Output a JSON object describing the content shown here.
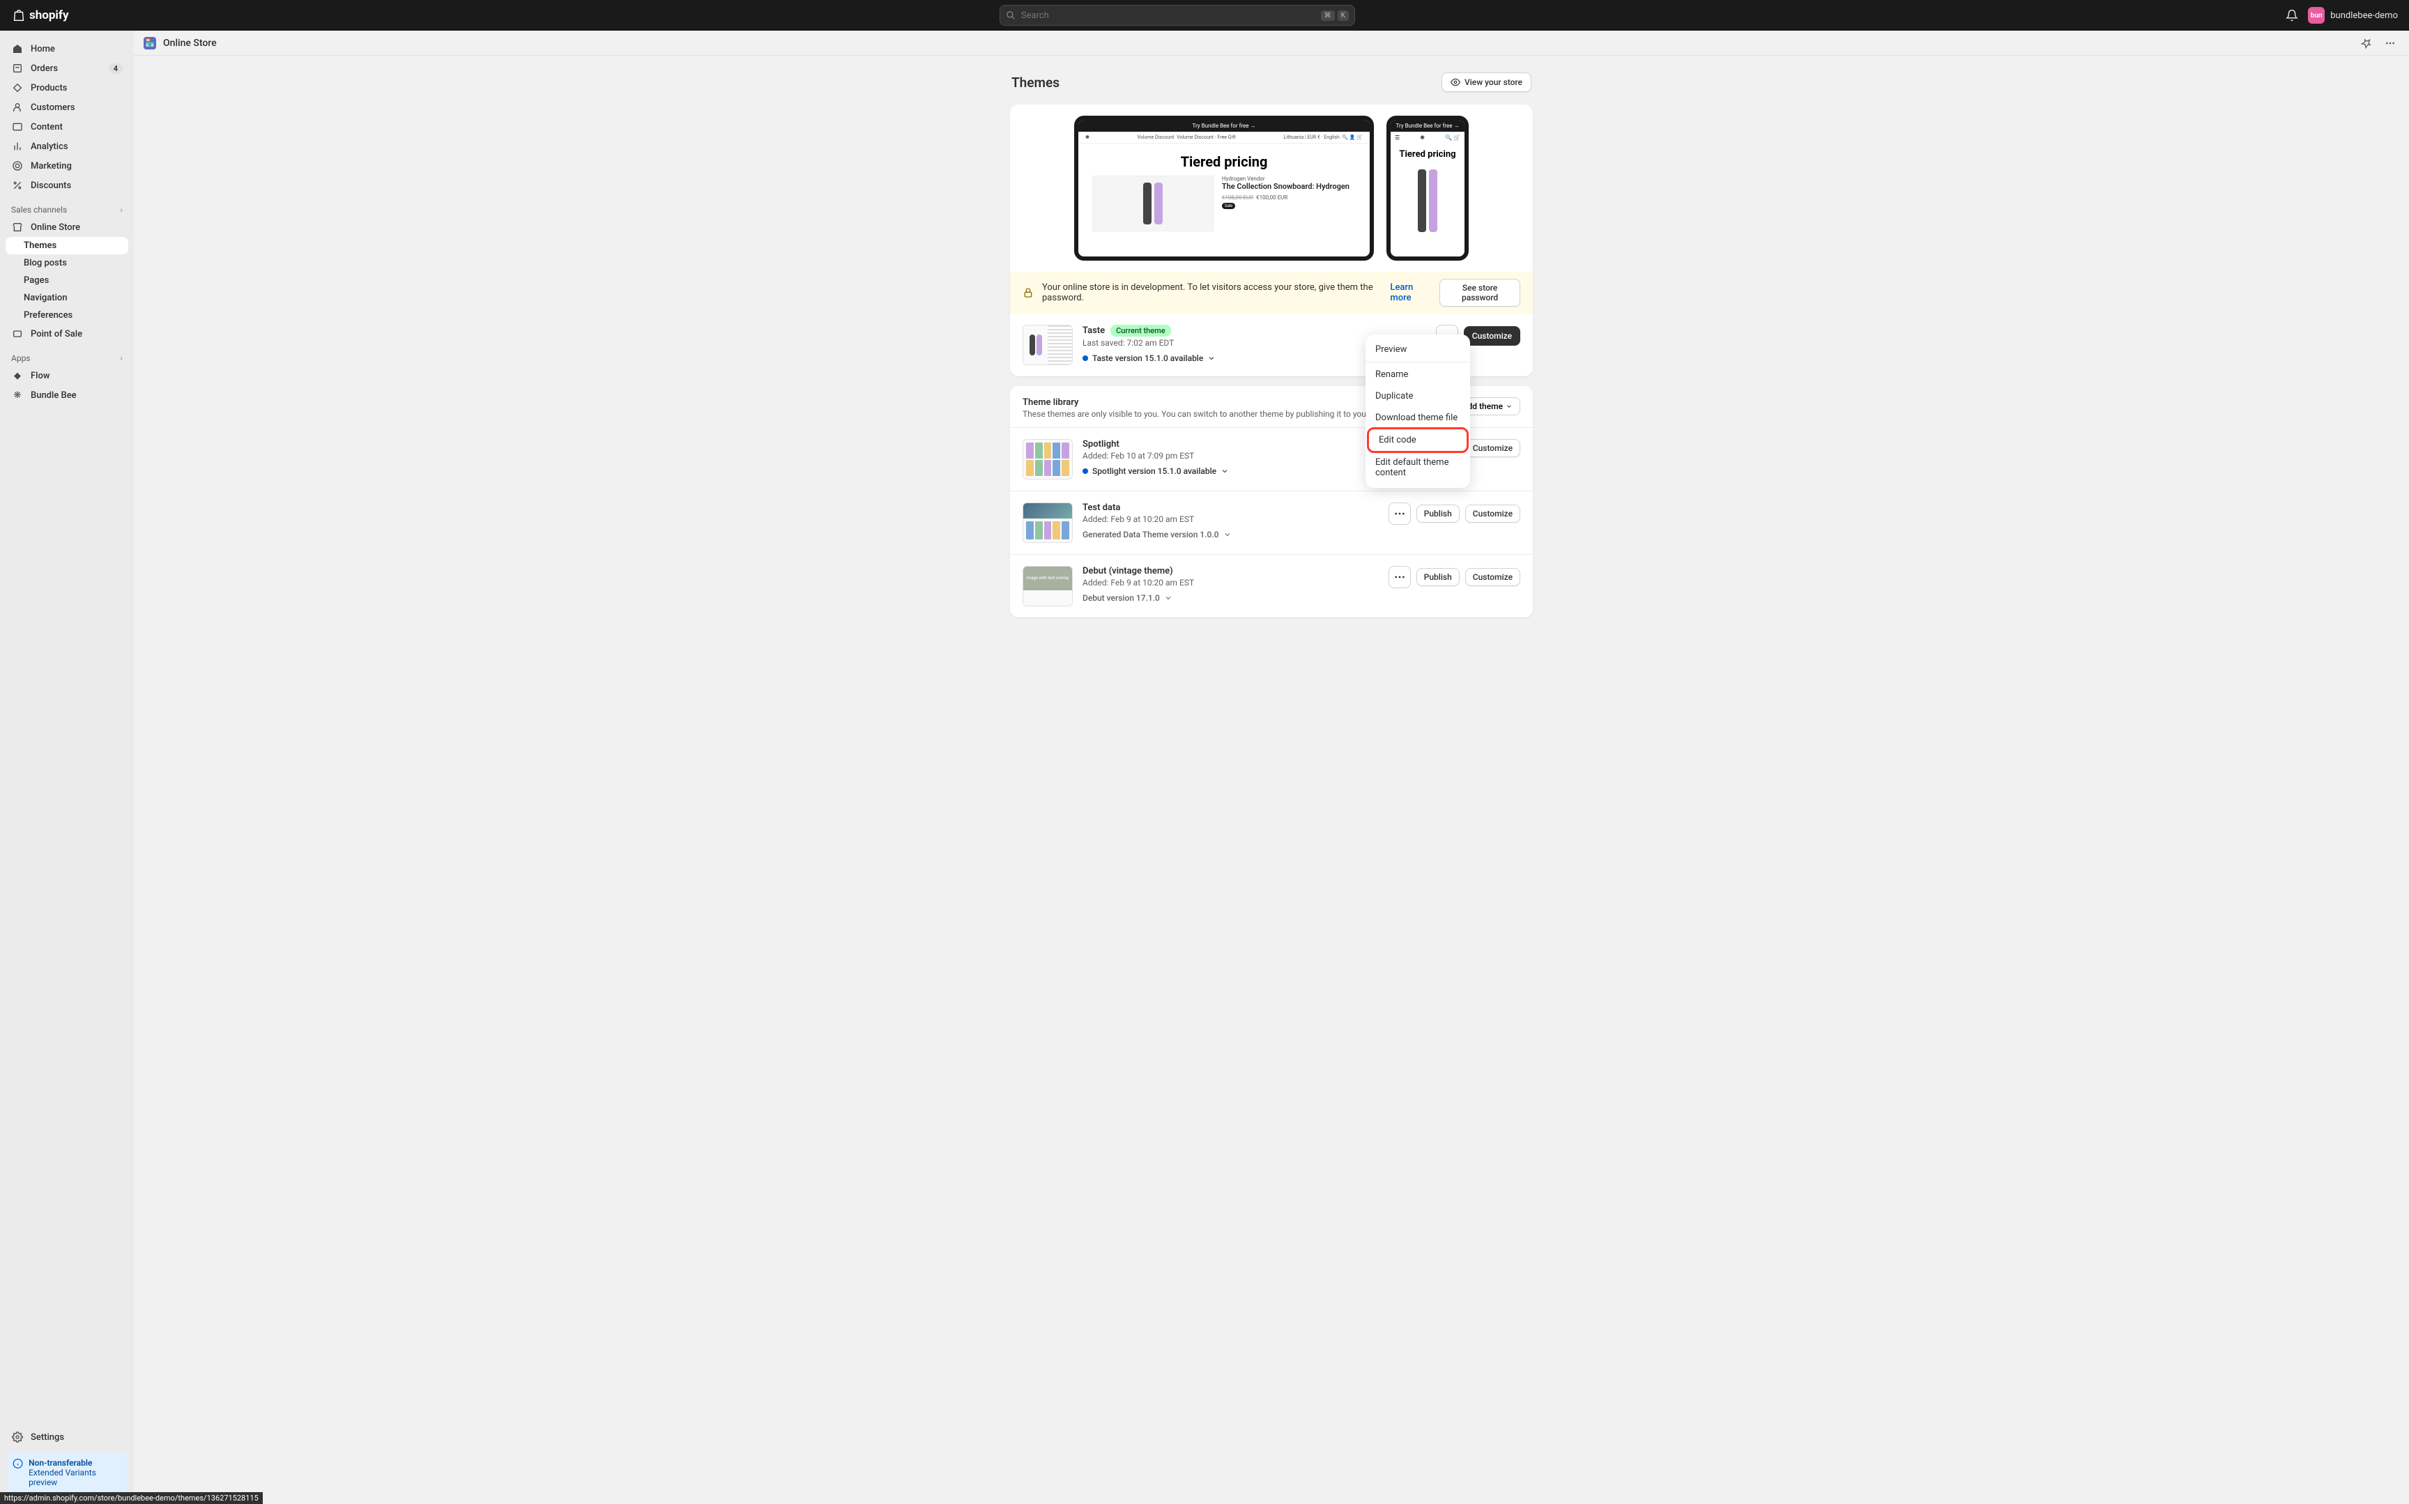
{
  "topbar": {
    "search_placeholder": "Search",
    "kbd1": "⌘",
    "kbd2": "K",
    "store_initials": "bun",
    "store_name": "bundlebee-demo"
  },
  "sidebar": {
    "nav": {
      "home": "Home",
      "orders": "Orders",
      "orders_badge": "4",
      "products": "Products",
      "customers": "Customers",
      "content": "Content",
      "analytics": "Analytics",
      "marketing": "Marketing",
      "discounts": "Discounts"
    },
    "sales_channels_label": "Sales channels",
    "online_store": "Online Store",
    "online_store_sub": {
      "themes": "Themes",
      "blog_posts": "Blog posts",
      "pages": "Pages",
      "navigation": "Navigation",
      "preferences": "Preferences"
    },
    "pos": "Point of Sale",
    "apps_label": "Apps",
    "flow": "Flow",
    "bundle_bee": "Bundle Bee",
    "settings": "Settings",
    "alert_title": "Non-transferable",
    "alert_sub": "Extended Variants preview"
  },
  "content_header": {
    "title": "Online Store"
  },
  "page": {
    "title": "Themes",
    "view_store": "View your store"
  },
  "preview": {
    "banner_text": "Try Bundle Bee for free →",
    "nav_left1": "Volume Discount",
    "nav_left2": "Volume Discount - Free Gift",
    "nav_right": "Lithuania | EUR € ·  English",
    "hero": "Tiered pricing",
    "vendor": "Hydrogen Vendor",
    "product_title": "The Collection Snowboard: Hydrogen",
    "old_price": "€105,00 EUR",
    "new_price": "€100,00 EUR",
    "sale": "Sale"
  },
  "dev_banner": {
    "text": "Your online store is in development. To let visitors access your store, give them the password.",
    "learn_more": "Learn more",
    "see_password": "See store password"
  },
  "current_theme": {
    "name": "Taste",
    "badge": "Current theme",
    "last_saved": "Last saved: 7:02 am EDT",
    "version": "Taste version 15.1.0 available",
    "customize": "Customize"
  },
  "dropdown": {
    "preview": "Preview",
    "rename": "Rename",
    "duplicate": "Duplicate",
    "download": "Download theme file",
    "edit_code": "Edit code",
    "edit_default": "Edit default theme content"
  },
  "library": {
    "title": "Theme library",
    "desc": "These themes are only visible to you. You can switch to another theme by publishing it to your store.",
    "add_theme": "Add theme",
    "themes": [
      {
        "name": "Spotlight",
        "added": "Added: Feb 10 at 7:09 pm EST",
        "version": "Spotlight version 15.1.0 available",
        "has_version": true
      },
      {
        "name": "Test data",
        "added": "Added: Feb 9 at 10:20 am EST",
        "version": "Generated Data Theme version 1.0.0",
        "has_version": false
      },
      {
        "name": "Debut (vintage theme)",
        "added": "Added: Feb 9 at 10:20 am EST",
        "version": "Debut version 17.1.0",
        "has_version": false
      }
    ],
    "publish": "Publish",
    "customize": "Customize"
  },
  "status_url": "https://admin.shopify.com/store/bundlebee-demo/themes/136271528115"
}
